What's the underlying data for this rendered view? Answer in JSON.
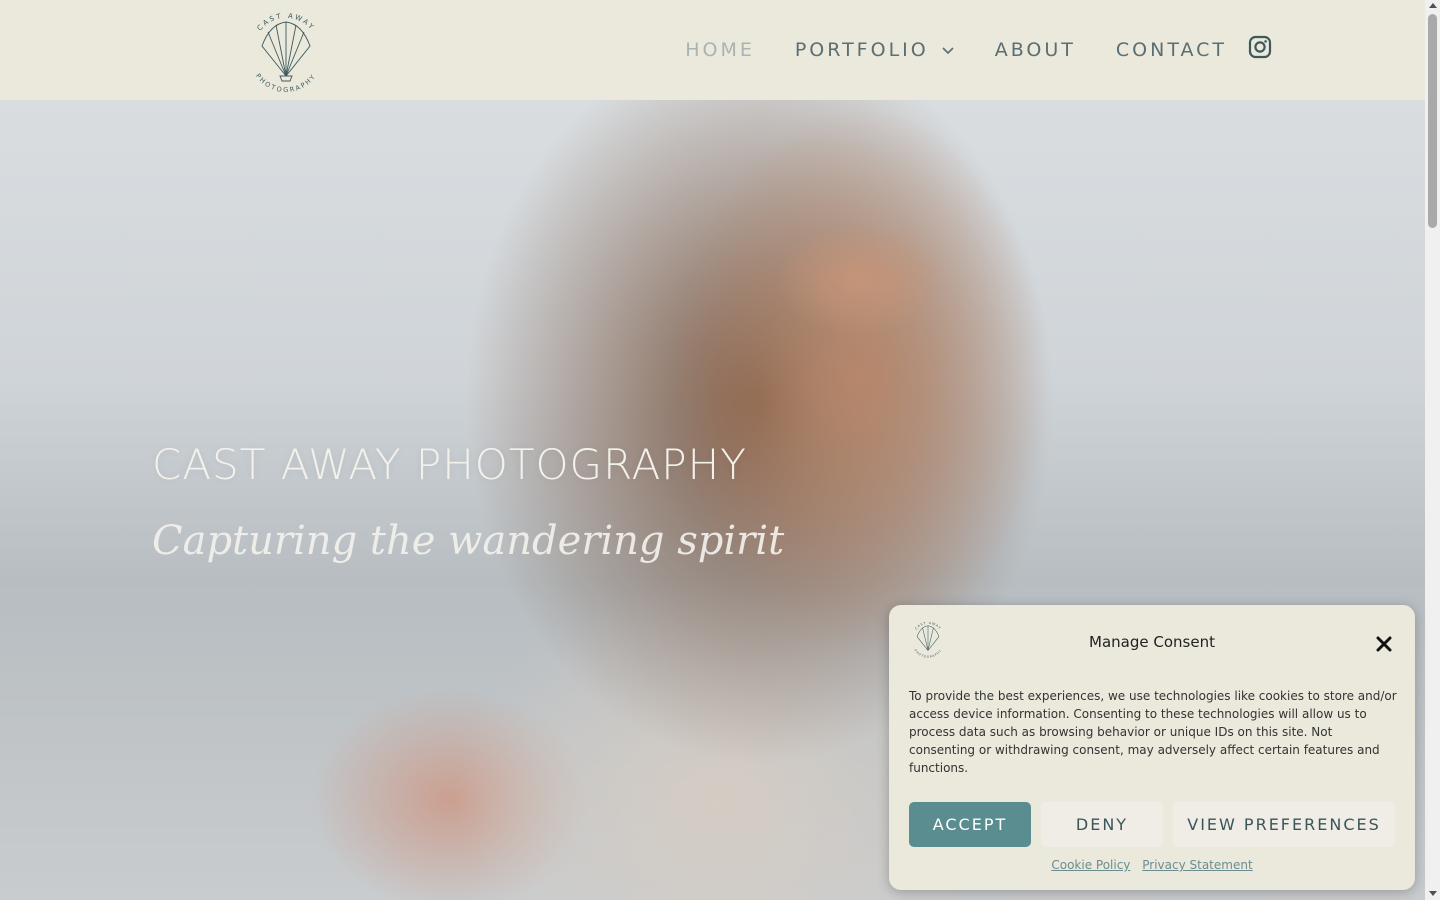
{
  "brand": {
    "logo_top_text": "CAST AWAY",
    "logo_bottom_text": "PHOTOGRAPHY"
  },
  "nav": {
    "items": [
      {
        "label": "HOME",
        "active": true
      },
      {
        "label": "PORTFOLIO",
        "active": false,
        "has_dropdown": true
      },
      {
        "label": "ABOUT",
        "active": false
      },
      {
        "label": "CONTACT",
        "active": false
      }
    ],
    "social_icon": "instagram-icon"
  },
  "hero": {
    "title": "CAST AWAY PHOTOGRAPHY",
    "tagline": "Capturing the wandering spirit"
  },
  "consent": {
    "title": "Manage Consent",
    "body": "To provide the best experiences, we use technologies like cookies to store and/or access device information. Consenting to these technologies will allow us to process data such as browsing behavior or unique IDs on this site. Not consenting or withdrawing consent, may adversely affect certain features and functions.",
    "accept_label": "ACCEPT",
    "deny_label": "DENY",
    "preferences_label": "VIEW PREFERENCES",
    "cookie_policy_label": "Cookie Policy",
    "privacy_statement_label": "Privacy Statement"
  },
  "colors": {
    "background": "#ebe8dc",
    "nav_text": "#5b6e72",
    "accent": "#5a8d90"
  }
}
